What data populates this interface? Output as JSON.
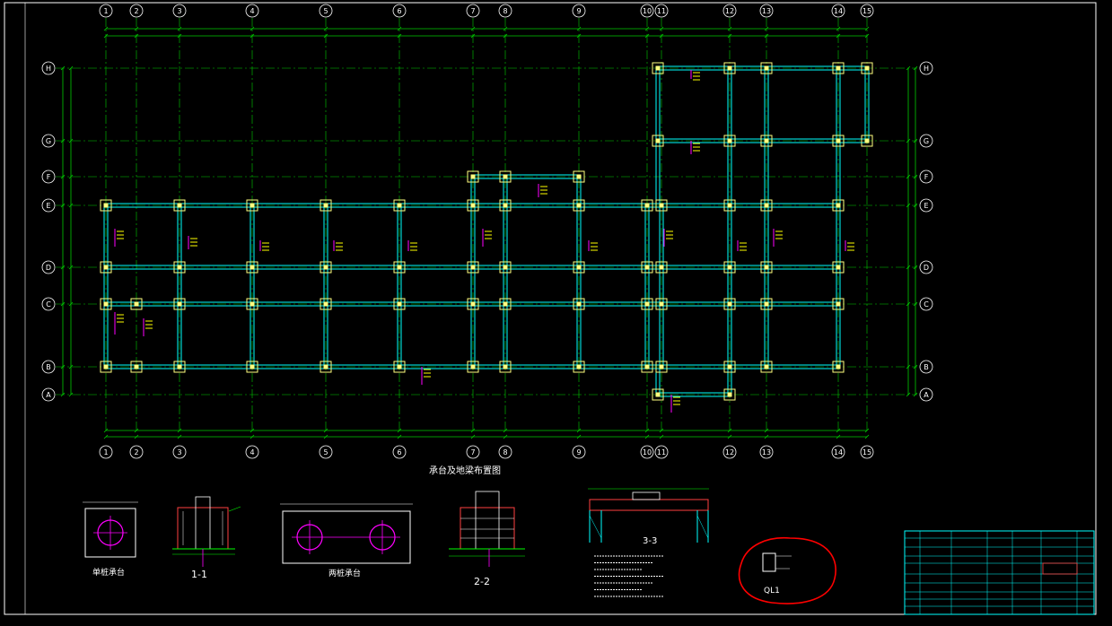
{
  "drawing": {
    "title": "承台及地梁布置图",
    "detail_labels": {
      "single_pile_cap": "单桩承台",
      "section_1": "1-1",
      "double_pile_cap": "两桩承台",
      "section_2": "2-2",
      "section_3": "3-3",
      "ql": "QL1"
    }
  },
  "axes": {
    "columns": [
      "1",
      "2",
      "3",
      "4",
      "5",
      "6",
      "7",
      "8",
      "9",
      "10",
      "11",
      "12",
      "13",
      "14",
      "15"
    ],
    "rows": [
      "H",
      "G",
      "F",
      "E",
      "D",
      "C",
      "B",
      "A"
    ]
  },
  "colors": {
    "background": "#000000",
    "grid_line": "#00cc00",
    "beam": "#00ffff",
    "column": "#ffff80",
    "annotation": "#ff00ff",
    "highlight_circle": "#ff0000",
    "border": "#ffffff"
  },
  "annotation": {
    "circle_note": "red hand-drawn circle around QL1 detail"
  }
}
